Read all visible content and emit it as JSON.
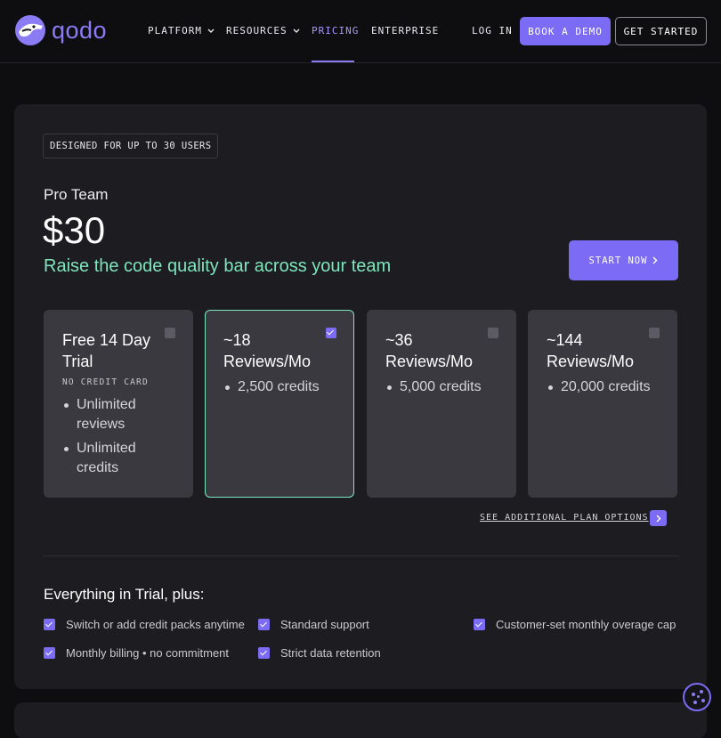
{
  "nav": {
    "logo_text": "qodo",
    "links": [
      {
        "label": "PLATFORM",
        "has_dropdown": true
      },
      {
        "label": "RESOURCES",
        "has_dropdown": true
      },
      {
        "label": "PRICING",
        "active": true
      },
      {
        "label": "ENTERPRISE"
      }
    ],
    "login_label": "LOG IN",
    "demo_label": "BOOK A DEMO",
    "get_started_label": "GET STARTED"
  },
  "plan": {
    "badge": "DESIGNED FOR UP TO 30 USERS",
    "name": "Pro Team",
    "price": "$30",
    "tagline": "Raise the code quality bar across your team",
    "cta_label": "START NOW",
    "tiers": [
      {
        "title": "Free 14 Day Trial",
        "subtitle": "NO CREDIT CARD",
        "bullets": [
          "Unlimited reviews",
          "Unlimited credits"
        ],
        "selected": false
      },
      {
        "title": "~18 Reviews/Mo",
        "bullets": [
          "2,500 credits"
        ],
        "selected": true
      },
      {
        "title": "~36 Reviews/Mo",
        "bullets": [
          "5,000 credits"
        ],
        "selected": false
      },
      {
        "title": "~144 Reviews/Mo",
        "bullets": [
          "20,000 credits"
        ],
        "selected": false
      }
    ],
    "more_options_label": "SEE ADDITIONAL PLAN OPTIONS",
    "features_heading": "Everything in Trial, plus:",
    "features": [
      "Switch or add credit packs anytime",
      "Standard support",
      "Customer-set monthly overage cap",
      "Monthly billing • no commitment",
      "Strict data retention"
    ]
  },
  "colors": {
    "accent": "#7c6cf5",
    "tagline": "#7ee6bd",
    "background": "#0e0e10",
    "card": "#1c1c21",
    "tier": "#3a3940"
  },
  "icons": [
    "qodo-logo-icon",
    "chevron-down-icon",
    "chevron-right-icon",
    "checkbox-checked-icon",
    "cookie-icon"
  ]
}
